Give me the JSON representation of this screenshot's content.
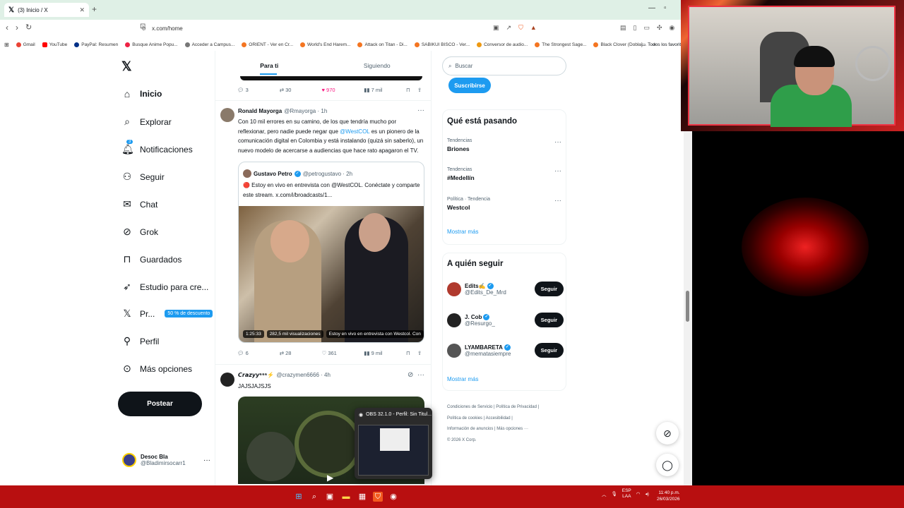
{
  "browser": {
    "tab_title": "(3) Inicio / X",
    "url": "x.com/home",
    "bookmarks": [
      "Gmail",
      "YouTube",
      "PayPal: Resumen",
      "Busque Anime Popu...",
      "Acceder a Campus...",
      "ORIENT - Ver en Cr...",
      "World's End Harem...",
      "Attack on Titan - Di...",
      "SABIKUI BISCO - Ver...",
      "Conversor de audio...",
      "The Strongest Sage...",
      "Black Clover (Dobla]..."
    ],
    "all_favorites": "Todos los favoritos"
  },
  "nav": {
    "items": [
      {
        "label": "Inicio",
        "icon": "home-icon"
      },
      {
        "label": "Explorar",
        "icon": "search-icon"
      },
      {
        "label": "Notificaciones",
        "icon": "bell-icon"
      },
      {
        "label": "Seguir",
        "icon": "person-add-icon"
      },
      {
        "label": "Chat",
        "icon": "mail-icon"
      },
      {
        "label": "Grok",
        "icon": "grok-icon"
      },
      {
        "label": "Guardados",
        "icon": "bookmark-icon"
      },
      {
        "label": "Estudio para cre...",
        "icon": "rocket-icon"
      },
      {
        "label": "Pr...",
        "icon": "x-logo-icon"
      },
      {
        "label": "Perfil",
        "icon": "person-icon"
      },
      {
        "label": "Más opciones",
        "icon": "more-circle-icon"
      }
    ],
    "notif_count": "3",
    "premium_badge": "50 % de descuento",
    "post_button": "Postear",
    "account_name": "Desoc Bla",
    "account_handle": "@Bladimirsocarr1"
  },
  "feed": {
    "tabs": [
      "Para ti",
      "Siguiendo"
    ],
    "prev_actions": {
      "replies": "3",
      "reposts": "30",
      "likes": "970",
      "views": "7 mil"
    },
    "tweet1": {
      "name": "Ronald Mayorga",
      "handle": "@Rmayorga · 1h",
      "text_a": "Con 10 mil errores en su camino, de los que tendría mucho por reflexionar, pero nadie puede negar que ",
      "mention": "@WestCOL",
      "text_b": " es un pionero de la comunicación digital en Colombia y está instalando (quizá sin saberlo), un nuevo modelo de acercarse a audiencias que hace rato apagaron el TV.",
      "quote_name": "Gustavo Petro",
      "quote_handle": "@petrogustavo · 2h",
      "quote_text": "🔴 Estoy en vivo en entrevista con @WestCOL. Conéctate y comparte este stream. x.com/i/broadcasts/1...",
      "video_duration": "1:25:33",
      "video_views": "282,5 mil visualizaciones",
      "video_title": "Estoy en vivo en entrevista con Westcol. Con",
      "actions": {
        "replies": "6",
        "reposts": "28",
        "likes": "361",
        "views": "9 mil"
      }
    },
    "tweet2": {
      "name": "𝘾𝙧𝙖𝙯𝙮𝙮⁶⁶⁶⚡",
      "handle": "@crazymen6666 · 4h",
      "text": "JAJSJAJSJS"
    }
  },
  "sidebar": {
    "search_placeholder": "Buscar",
    "subscribe": "Suscribirse",
    "trending_title": "Qué está pasando",
    "trends": [
      {
        "meta": "Tendencias",
        "name": "Briones"
      },
      {
        "meta": "Tendencias",
        "name": "#Medellín"
      },
      {
        "meta": "Política · Tendencia",
        "name": "Westcol"
      }
    ],
    "show_more": "Mostrar más",
    "who_title": "A quién seguir",
    "who": [
      {
        "name": "Edits✍️",
        "handle": "@Edits_De_Mrd",
        "color": "#b03a2e"
      },
      {
        "name": "J. Cob",
        "handle": "@Resurgo_",
        "color": "#222222"
      },
      {
        "name": "LYAMBARETA",
        "handle": "@mematasiempre",
        "color": "#555555"
      }
    ],
    "follow_label": "Seguir",
    "footer_lines": [
      "Condiciones de Servicio  |  Política de Privacidad  |",
      "Política de cookies  |  Accesibilidad  |",
      "Información de anuncios  |  Más opciones ···",
      "© 2026 X Corp."
    ]
  },
  "taskbar": {
    "obs_title": "OBS 32.1.0 - Perfil: Sin Titul...",
    "lang": "ESP",
    "lang2": "LAA",
    "time": "11:40 p.m.",
    "date": "26/03/2026"
  },
  "colors": {
    "accent": "#1d9bf0",
    "like": "#f91880",
    "taskbar": "#b80f10"
  }
}
